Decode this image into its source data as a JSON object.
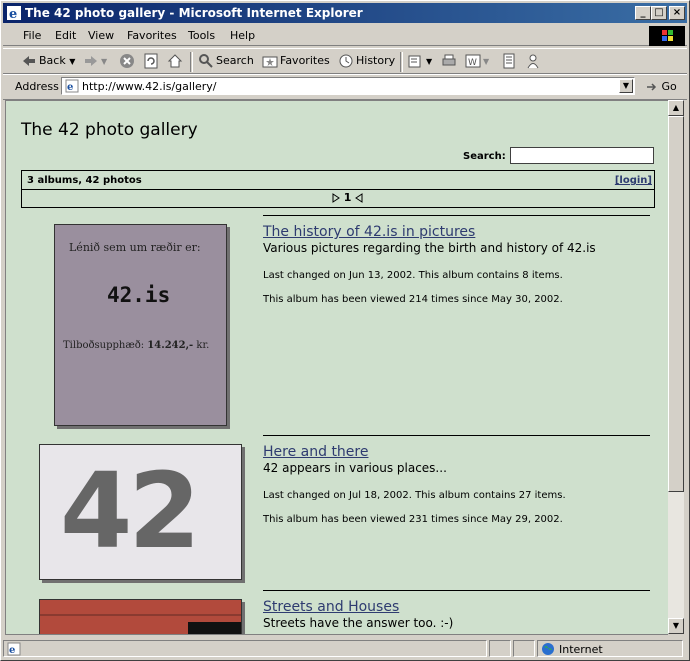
{
  "window": {
    "title": "The 42 photo gallery - Microsoft Internet Explorer"
  },
  "menu": [
    "File",
    "Edit",
    "View",
    "Favorites",
    "Tools",
    "Help"
  ],
  "toolbar": {
    "back": "Back",
    "search": "Search",
    "favorites": "Favorites",
    "history": "History"
  },
  "address": {
    "label": "Address",
    "url": "http://www.42.is/gallery/",
    "go": "Go"
  },
  "page": {
    "title": "The 42 photo gallery",
    "search_label": "Search:",
    "album_count": "3 albums, 42 photos",
    "login": "[login]",
    "current_page": "1"
  },
  "albums": [
    {
      "title": "The history of 42.is in pictures",
      "description": "Various pictures regarding the birth and history of 42.is",
      "changed": "Last changed on Jun 13, 2002. This album contains 8 items.",
      "views": "This album has been viewed 214 times since May 30, 2002.",
      "thumb_line1": "Lénið sem um ræðir er:",
      "thumb_line2": "42.is",
      "thumb_line3a": "Tilboðsupphæð: ",
      "thumb_line3b": "14.242,-",
      "thumb_line3c": " kr."
    },
    {
      "title": "Here and there",
      "description": "42 appears in various places...",
      "changed": "Last changed on Jul 18, 2002. This album contains 27 items.",
      "views": "This album has been viewed 231 times since May 29, 2002.",
      "thumb_text": "42"
    },
    {
      "title": "Streets and Houses",
      "description": "Streets have the answer too. :-)"
    }
  ],
  "status": {
    "zone": "Internet"
  }
}
